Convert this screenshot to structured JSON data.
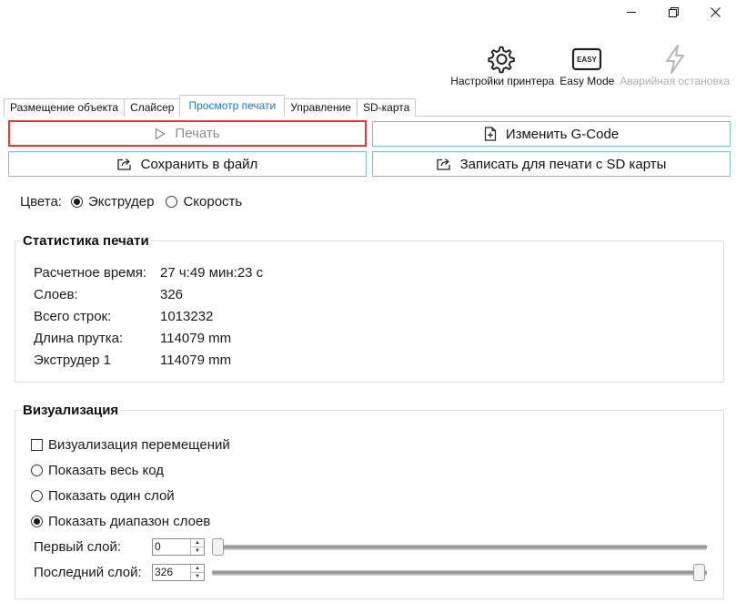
{
  "toolbar": {
    "printer_settings": "Настройки принтера",
    "easy_mode": "Easy Mode",
    "easy_badge": "EASY",
    "emergency_stop": "Аварийная остановка"
  },
  "tabs": [
    {
      "label": "Размещение объекта"
    },
    {
      "label": "Слайсер"
    },
    {
      "label": "Просмотр печати",
      "active": true
    },
    {
      "label": "Управление"
    },
    {
      "label": "SD-карта"
    }
  ],
  "actions": {
    "print": "Печать",
    "edit_gcode": "Изменить G-Code",
    "save_file": "Сохранить в файл",
    "write_sd": "Записать для печати с SD карты"
  },
  "colors": {
    "label": "Цвета:",
    "extruder": "Экструдер",
    "speed": "Скорость",
    "selected": "extruder"
  },
  "stats": {
    "title": "Статистика печати",
    "rows": [
      {
        "key": "Расчетное время:",
        "value": "27 ч:49 мин:23 с"
      },
      {
        "key": "Слоев:",
        "value": "326"
      },
      {
        "key": "Всего строк:",
        "value": "1013232"
      },
      {
        "key": "Длина прутка:",
        "value": "114079 mm"
      },
      {
        "key": "Экструдер 1",
        "value": "114079 mm"
      }
    ]
  },
  "viz": {
    "title": "Визуализация",
    "show_moves": "Визуализация перемещений",
    "show_all": "Показать весь код",
    "show_one": "Показать один слой",
    "show_range": "Показать диапазон слоев",
    "first_layer_label": "Первый слой:",
    "first_layer_value": "0",
    "last_layer_label": "Последний слой:",
    "last_layer_value": "326",
    "first_layer_fraction": 0,
    "last_layer_fraction": 1
  },
  "accent_color": "#1777c5",
  "button_border_color": "#7bbfd3",
  "highlight_color": "#e23a3a"
}
